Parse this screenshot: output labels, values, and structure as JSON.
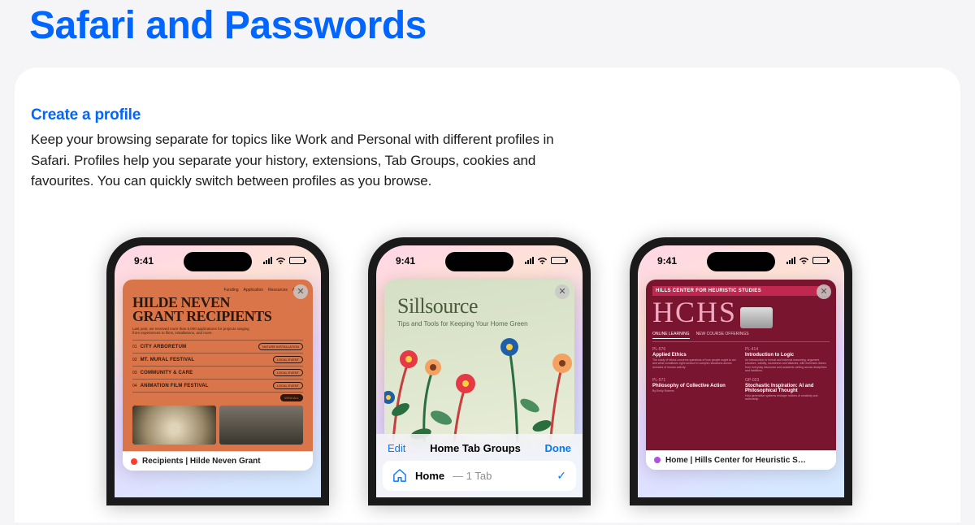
{
  "page": {
    "title": "Safari and Passwords"
  },
  "feature": {
    "heading": "Create a profile",
    "body": "Keep your browsing separate for topics like Work and Personal with different profiles in Safari. Profiles help you separate your history, extensions, Tab Groups, cookies and favourites. You can quickly switch between profiles as you browse."
  },
  "status": {
    "time": "9:41"
  },
  "phone1": {
    "nav": [
      "Funding",
      "Application",
      "Resources",
      "About"
    ],
    "title_line1": "HILDE NEVEN",
    "title_line2": "GRANT RECIPIENTS",
    "subtitle": "Last year, we received more than 6,000 applications for projects ranging from experiences to films, installations, and more.",
    "items": [
      {
        "num": "01",
        "title": "CITY ARBORETUM",
        "badge": "NATURE INSTALLATION"
      },
      {
        "num": "02",
        "title": "MT. MURAL FESTIVAL",
        "badge": "LOCAL EVENT"
      },
      {
        "num": "03",
        "title": "COMMUNITY & CARE",
        "badge": "LOCAL EVENT"
      },
      {
        "num": "04",
        "title": "ANIMATION FILM FESTIVAL",
        "badge": "LOCAL EVENT"
      }
    ],
    "view_all": "VIEW ALL",
    "tab_label": "Recipients | Hilde Neven Grant"
  },
  "phone2": {
    "title": "Sillsource",
    "subtitle": "Tips and Tools for Keeping Your Home Green",
    "groups": {
      "edit": "Edit",
      "title": "Home Tab Groups",
      "done": "Done",
      "row_label": "Home",
      "row_count": "— 1 Tab"
    }
  },
  "phone3": {
    "banner": "HILLS CENTER FOR HEURISTIC STUDIES",
    "logo": "HCHS",
    "tabs": [
      "ONLINE LEARNING",
      "NEW COURSE OFFERINGS"
    ],
    "courses": [
      {
        "code": "PL-576",
        "title": "Applied Ethics"
      },
      {
        "code": "PL-414",
        "title": "Introduction to Logic"
      },
      {
        "code": "PL-571",
        "title": "Philosophy of Collective Action"
      },
      {
        "code": "GP-023",
        "title": "Stochastic Inspiration: AI and Philosophical Thought"
      }
    ],
    "tab_label": "Home | Hills Center for Heuristic S…"
  }
}
